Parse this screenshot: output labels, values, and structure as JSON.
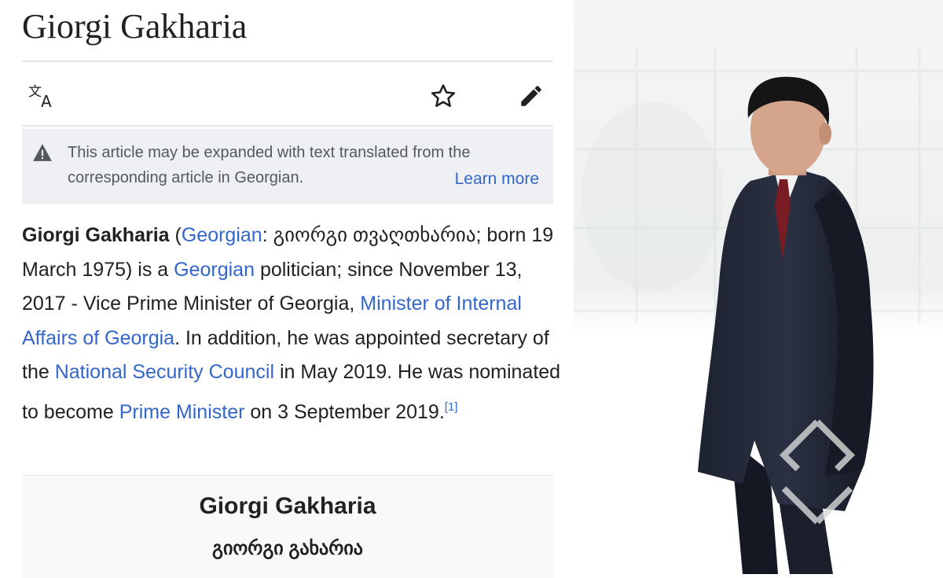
{
  "article": {
    "title": "Giorgi Gakharia",
    "toolbar": {
      "language_icon": "translate-icon",
      "watch_icon": "star-icon",
      "edit_icon": "pencil-icon"
    },
    "notice": {
      "text": "This article may be expanded with text translated from the corresponding article in Georgian.",
      "link": "Learn more",
      "icon": "warning-icon"
    },
    "lead": {
      "name": "Giorgi Gakharia",
      "t1": " (",
      "link_georgian1": "Georgian",
      "t2": ": გიორგი თვაღთხარია; born 19 March 1975) is a ",
      "link_georgian2": "Georgian",
      "t3": " politician; since November 13, 2017 - Vice Prime Minister of Georgia, ",
      "link_ministry": "Minister of Internal Affairs of Georgia",
      "t4": ". In addition, he was appointed secretary of the ",
      "link_nsc": "National Security Council",
      "t5": " in May 2019. He was nominated to become ",
      "link_pm": "Prime Minister",
      "t6": " on 3 September 2019.",
      "ref": "[1]"
    },
    "infobox": {
      "title": "Giorgi Gakharia",
      "native_name": "გიორგი გახარია"
    }
  },
  "colors": {
    "link": "#3366cc",
    "text": "#202122",
    "notice_bg": "#eef0f3"
  }
}
